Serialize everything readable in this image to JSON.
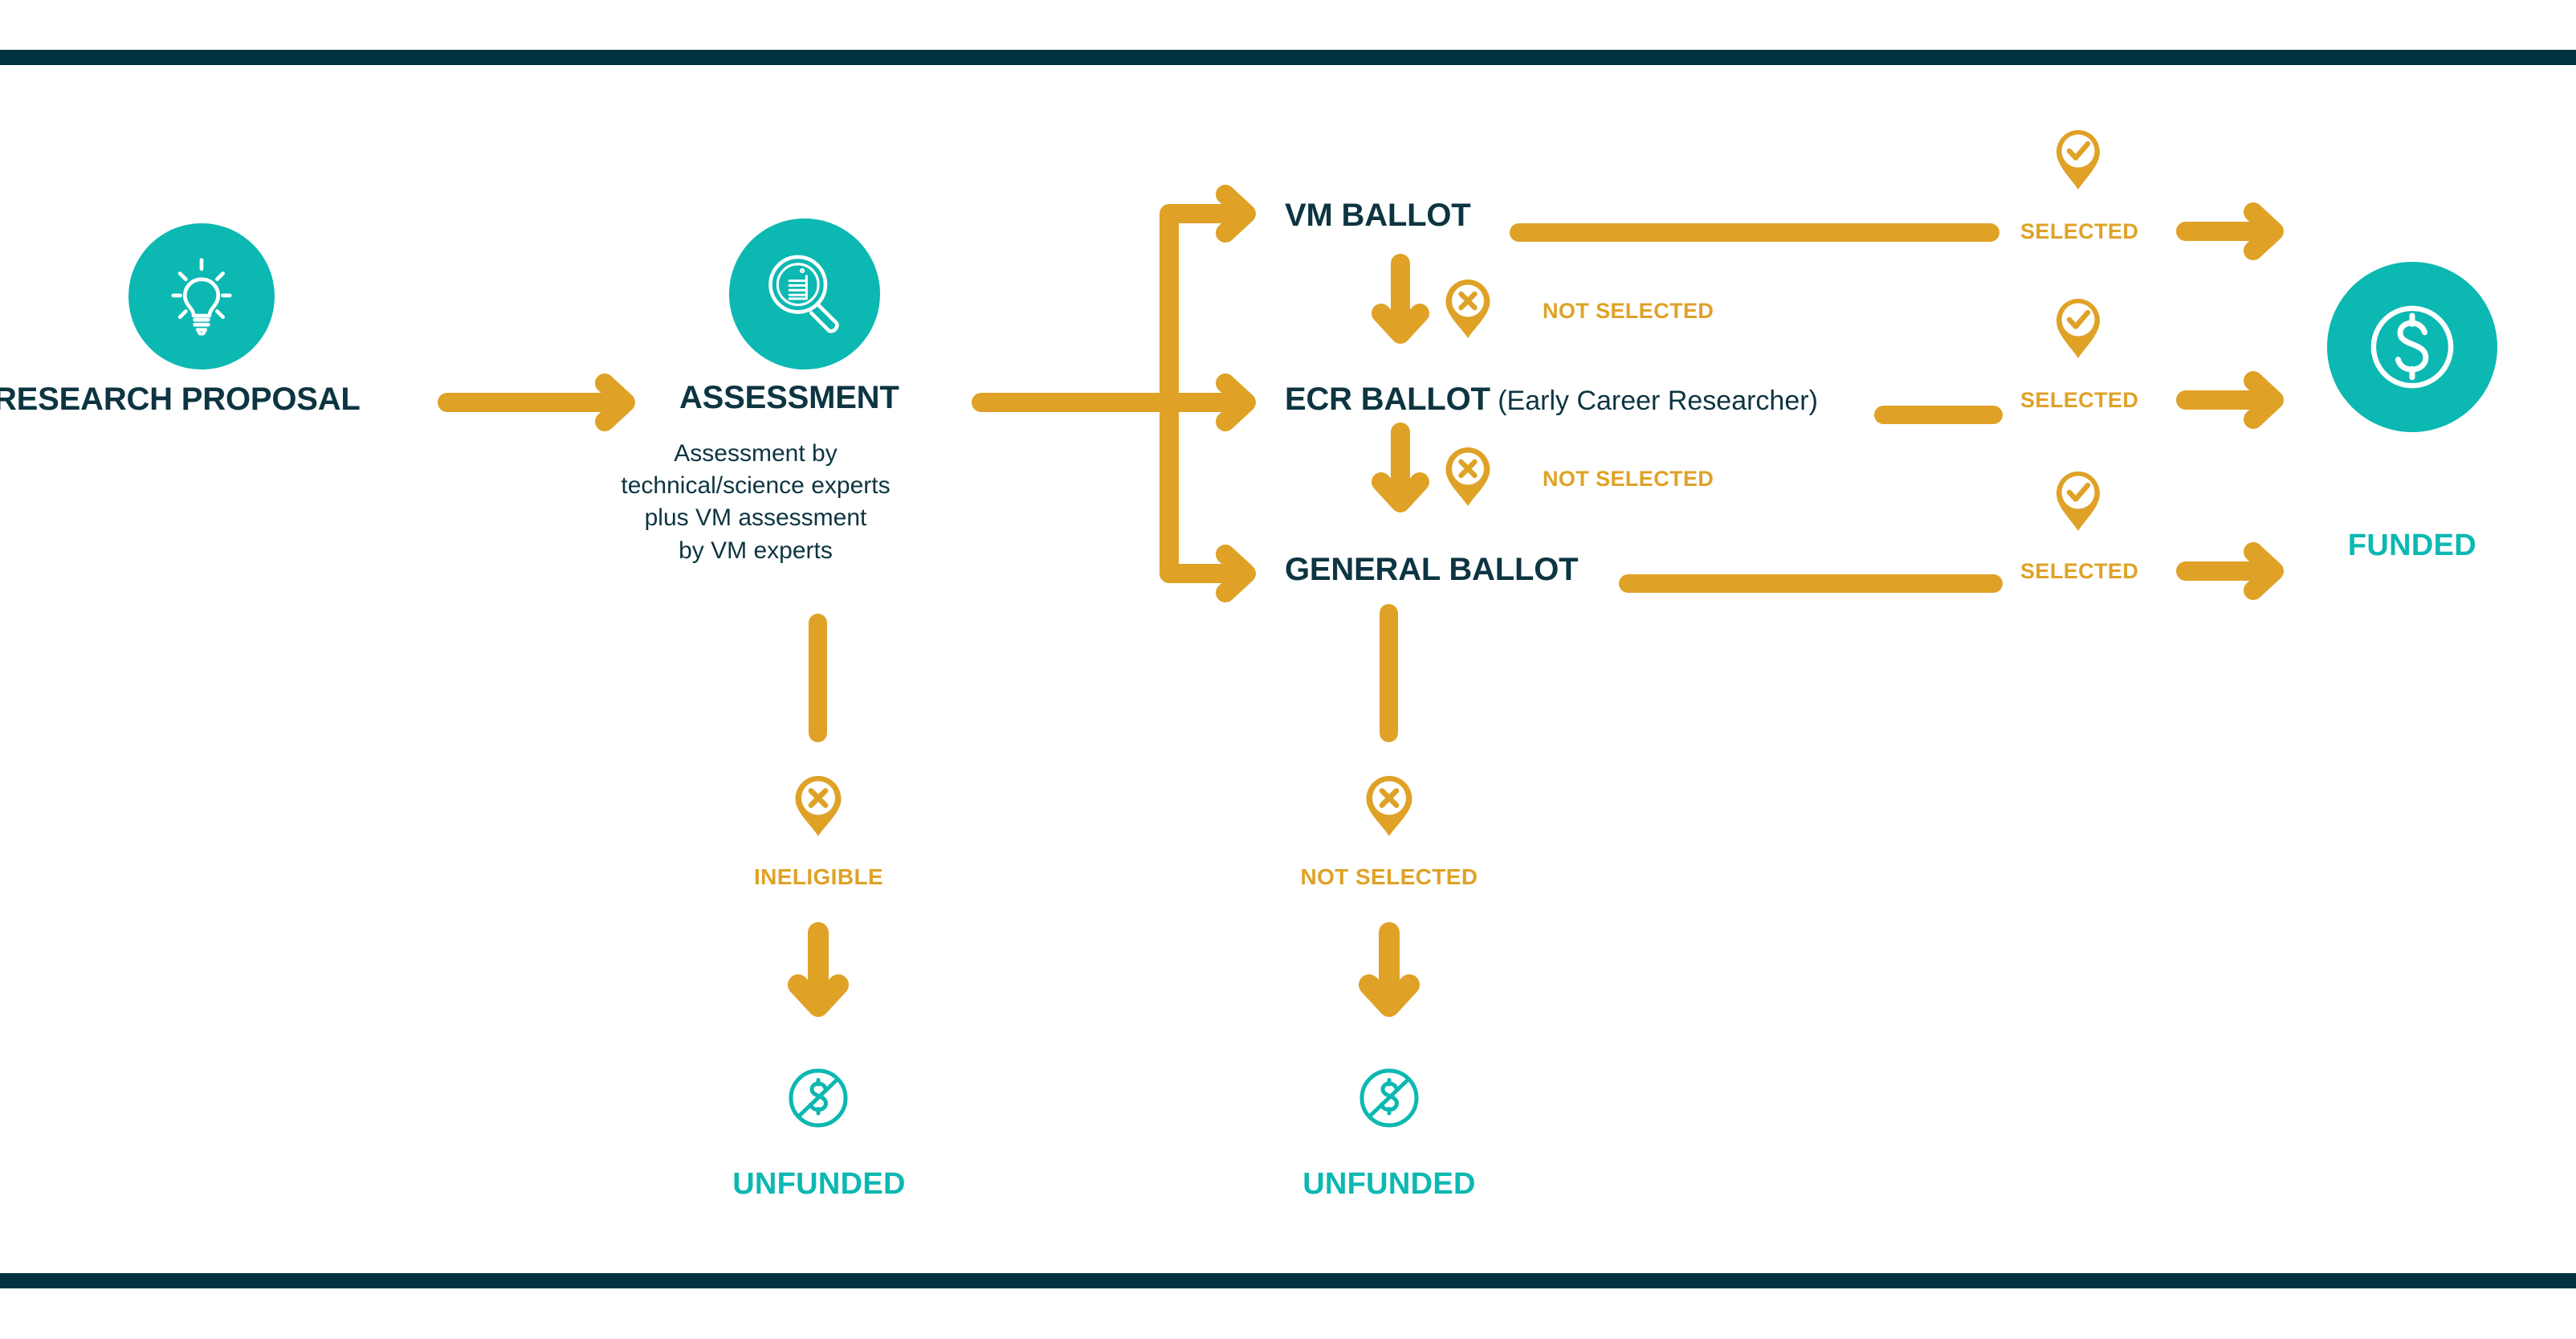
{
  "diagram": {
    "title": "Research proposal assessment and ballot funding pathway",
    "colors": {
      "gold": "#DFA227",
      "teal": "#0CB8B2",
      "navy": "#00333F",
      "text_navy": "#0D3541",
      "background": "#FFFFFF"
    }
  },
  "stages": {
    "research_proposal": {
      "label": "RESEARCH PROPOSAL",
      "icon": "lightbulb-icon"
    },
    "assessment": {
      "label": "ASSESSMENT",
      "icon": "magnifier-document-icon",
      "description_lines": [
        "Assessment by",
        "technical/science experts",
        "plus VM assessment",
        "by VM experts"
      ]
    },
    "funded": {
      "label": "FUNDED",
      "icon": "dollar-circle-icon"
    }
  },
  "ballots": [
    {
      "name": "VM BALLOT",
      "qualifier": "",
      "outcome_selected": "SELECTED",
      "outcome_rejected": "NOT SELECTED",
      "selected_icon": "pin-check-icon",
      "rejected_icon": "pin-cross-icon"
    },
    {
      "name": "ECR BALLOT",
      "qualifier": "(Early Career Researcher)",
      "outcome_selected": "SELECTED",
      "outcome_rejected": "NOT SELECTED",
      "selected_icon": "pin-check-icon",
      "rejected_icon": "pin-cross-icon"
    },
    {
      "name": "GENERAL BALLOT",
      "qualifier": "",
      "outcome_selected": "SELECTED",
      "outcome_rejected": "NOT SELECTED",
      "selected_icon": "pin-check-icon",
      "rejected_icon": "pin-cross-icon"
    }
  ],
  "terminal_outcomes": {
    "ineligible": {
      "label": "INELIGIBLE",
      "icon": "pin-cross-icon",
      "result_label": "UNFUNDED",
      "result_icon": "dollar-crossed-icon"
    },
    "not_selected": {
      "label": "NOT SELECTED",
      "icon": "pin-cross-icon",
      "result_label": "UNFUNDED",
      "result_icon": "dollar-crossed-icon"
    }
  }
}
